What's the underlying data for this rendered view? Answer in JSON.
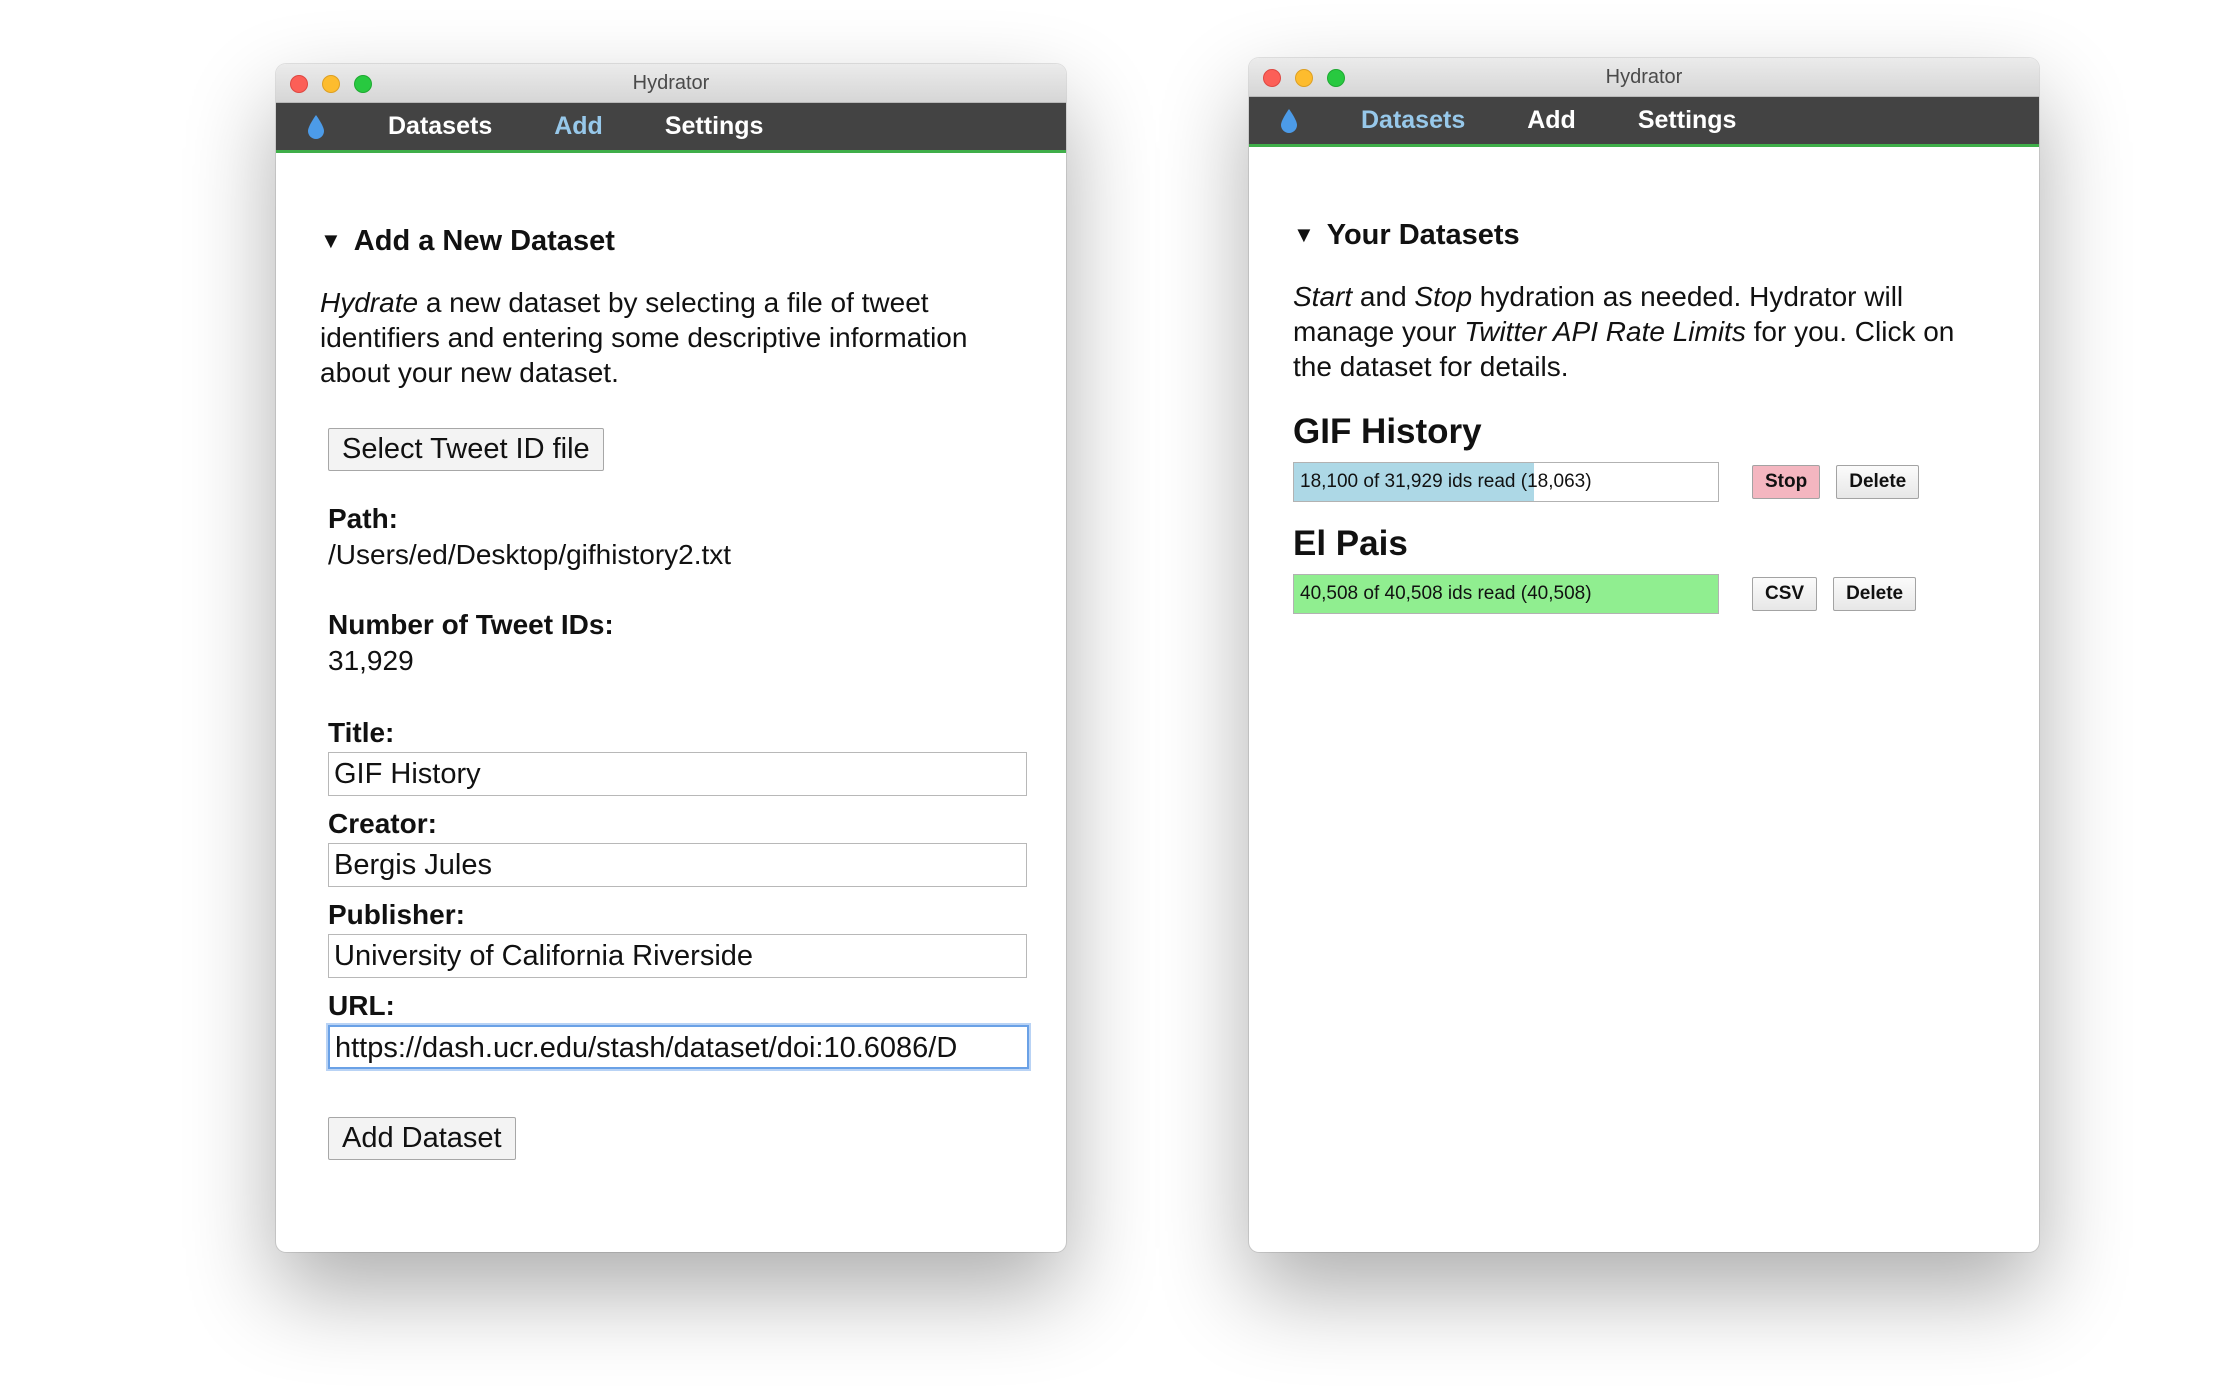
{
  "colors": {
    "nav_bg": "#434343",
    "nav_border": "#3fae49",
    "nav_active": "#97c8ea",
    "progress_in_progress": "#add8e6",
    "progress_complete": "#90ee90",
    "stop_button": "#f4b6c0",
    "logo": "#4c9be8"
  },
  "left_window": {
    "window_title": "Hydrator",
    "nav": {
      "logo_icon": "water-drop-icon",
      "datasets": "Datasets",
      "add": "Add",
      "settings": "Settings",
      "active": "add"
    },
    "section_title": "Add a New Dataset",
    "intro_em": "Hydrate",
    "intro_line1": " a new dataset by selecting a file of tweet",
    "intro_line2": "identifiers and entering some descriptive information",
    "intro_line3": "about your new dataset.",
    "select_button": "Select Tweet ID file",
    "path_label": "Path:",
    "path_value": "/Users/ed/Desktop/gifhistory2.txt",
    "count_label": "Number of Tweet IDs:",
    "count_value": "31,929",
    "title_label": "Title:",
    "title_value": "GIF History",
    "creator_label": "Creator:",
    "creator_value": "Bergis Jules",
    "publisher_label": "Publisher:",
    "publisher_value": "University of California Riverside",
    "url_label": "URL:",
    "url_value": "https://dash.ucr.edu/stash/dataset/doi:10.6086/D",
    "add_button": "Add Dataset"
  },
  "right_window": {
    "window_title": "Hydrator",
    "nav": {
      "logo_icon": "water-drop-icon",
      "datasets": "Datasets",
      "add": "Add",
      "settings": "Settings",
      "active": "datasets"
    },
    "section_title": "Your Datasets",
    "intro_em1": "Start",
    "intro_mid1": " and ",
    "intro_em2": "Stop",
    "intro_rest1": " hydration as needed. Hydrator will",
    "intro_line2_a": "manage your ",
    "intro_em3": "Twitter API Rate Limits",
    "intro_line2_b": " for you. Click on",
    "intro_line3": "the dataset for details.",
    "datasets": [
      {
        "title": "GIF History",
        "progress_text": "18,100 of 31,929 ids read (18,063)",
        "progress_fraction": 0.567,
        "buttons": [
          "Stop",
          "Delete"
        ]
      },
      {
        "title": "El Pais",
        "progress_text": "40,508 of 40,508 ids read (40,508)",
        "progress_fraction": 1.0,
        "buttons": [
          "CSV",
          "Delete"
        ]
      }
    ]
  }
}
